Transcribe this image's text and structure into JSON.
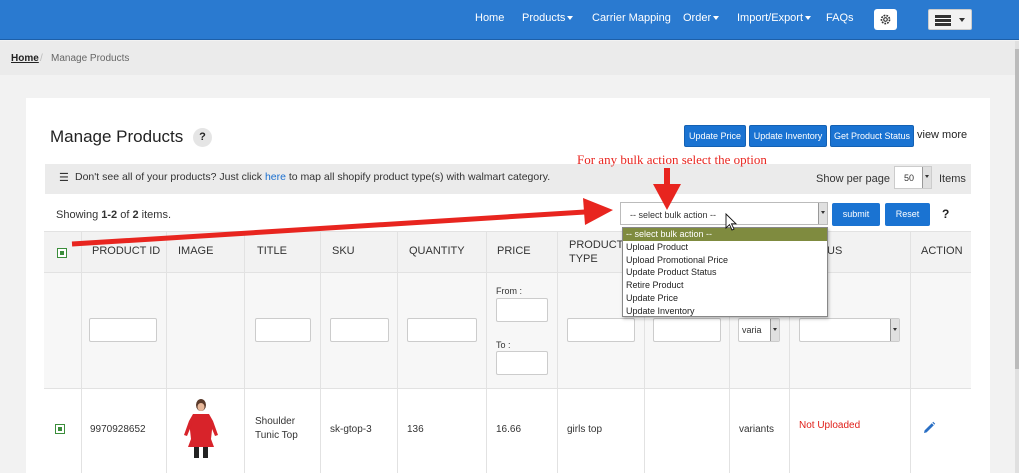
{
  "nav": {
    "items": [
      {
        "label": "Home",
        "caret": false
      },
      {
        "label": "Products",
        "caret": true
      },
      {
        "label": "Carrier Mapping",
        "caret": false
      },
      {
        "label": "Order",
        "caret": true
      },
      {
        "label": "Import/Export",
        "caret": true
      },
      {
        "label": "FAQs",
        "caret": false
      }
    ],
    "settings_icon": "gear-icon",
    "user_icon": "user-menu-icon",
    "accent_color": "#2a7ad0"
  },
  "breadcrumb": {
    "home": "Home",
    "current": "Manage Products"
  },
  "page": {
    "title": "Manage Products",
    "help": "?",
    "actions": {
      "update_price": "Update Price",
      "update_inventory": "Update Inventory",
      "get_product_status": "Get Product Status",
      "view_more": "view more"
    }
  },
  "infobar": {
    "prefix": "Don't see all of your products? Just click",
    "link": "here",
    "suffix": "to map all shopify product type(s) with walmart category.",
    "show_per_page": "Show per page",
    "per_page_value": "50",
    "items_label": "Items"
  },
  "annotation": {
    "text": "For any bulk action select the option",
    "color": "#e8251f"
  },
  "listing": {
    "showing_prefix": "Showing",
    "range": "1-2",
    "of": "of",
    "total": "2",
    "items": "items."
  },
  "bulk": {
    "selected": "-- select bulk action --",
    "options": [
      "-- select bulk action --",
      "Upload Product",
      "Upload Promotional Price",
      "Update Product Status",
      "Retire Product",
      "Update Price",
      "Update Inventory"
    ],
    "submit": "submit",
    "reset": "Reset",
    "help": "?"
  },
  "table": {
    "headers": [
      "PRODUCT ID",
      "IMAGE",
      "TITLE",
      "SKU",
      "QUANTITY",
      "PRICE",
      "PRODUCT TYPE",
      "US",
      "ACTION"
    ],
    "filters": {
      "from_label": "From :",
      "to_label": "To :",
      "variant_select": "varia"
    },
    "rows": [
      {
        "product_id": "9970928652",
        "title_line1": "Shoulder",
        "title_line2": "Tunic Top",
        "sku": "sk-gtop-3",
        "quantity": "136",
        "price": "16.66",
        "product_type": "girls top",
        "variants": "variants",
        "status": "Not Uploaded"
      }
    ]
  }
}
